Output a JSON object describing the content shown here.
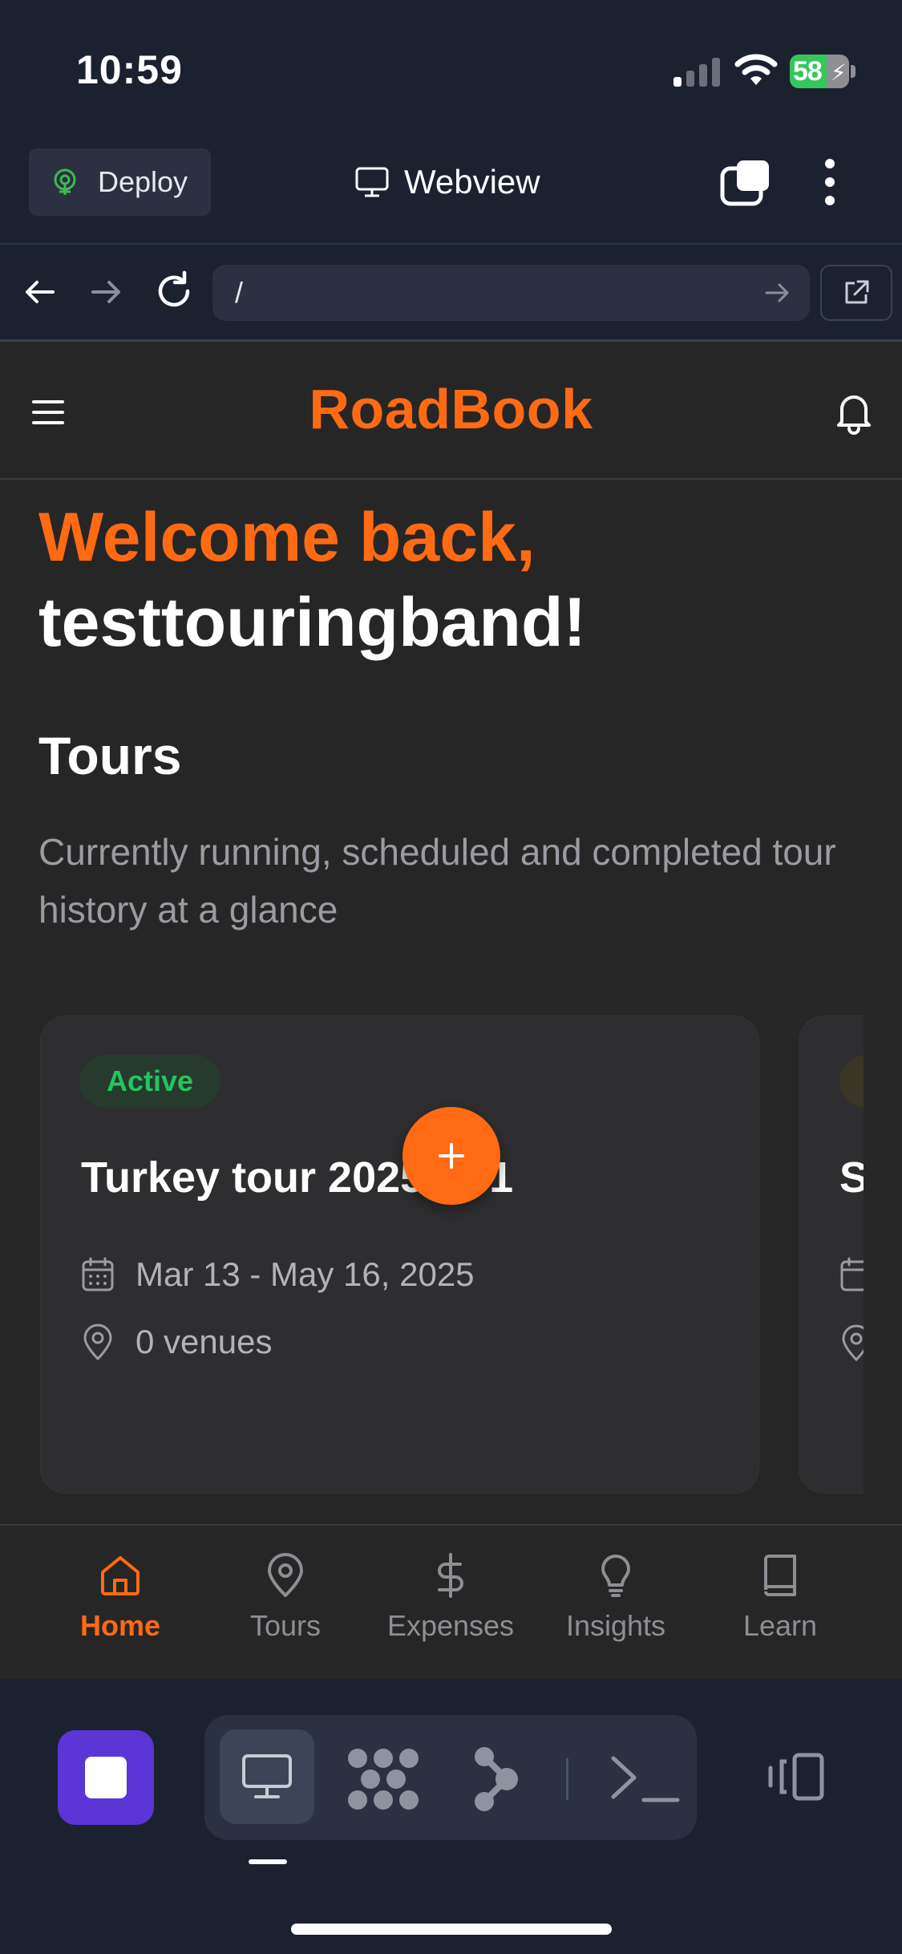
{
  "status_bar": {
    "time": "10:59",
    "battery": "58",
    "icons": [
      "signal-icon",
      "wifi-icon",
      "battery-icon"
    ]
  },
  "host_toolbar": {
    "deploy_label": "Deploy",
    "webview_label": "Webview",
    "icons": [
      "deploy-icon",
      "monitor-icon",
      "windows-icon",
      "kebab-menu-icon"
    ]
  },
  "browser": {
    "url": "/",
    "icons": [
      "back-icon",
      "forward-icon",
      "reload-icon",
      "go-arrow-icon",
      "open-external-icon"
    ]
  },
  "app": {
    "brand": "RoadBook",
    "welcome_line": "Welcome back,",
    "username_line": "testtouringband!",
    "tours_heading": "Tours",
    "tours_subtitle": "Currently running, scheduled and completed tour history at a glance",
    "tour_cards": [
      {
        "status": "Active",
        "title": "Turkey tour 2025 pt 1",
        "dates": "Mar 13 - May 16, 2025",
        "venues": "0 venues"
      },
      {
        "title": "S"
      }
    ],
    "fab_label": "+",
    "tabs": [
      {
        "label": "Home",
        "icon": "home-icon",
        "active": true
      },
      {
        "label": "Tours",
        "icon": "map-pin-icon",
        "active": false
      },
      {
        "label": "Expenses",
        "icon": "dollar-icon",
        "active": false
      },
      {
        "label": "Insights",
        "icon": "lightbulb-icon",
        "active": false
      },
      {
        "label": "Learn",
        "icon": "book-icon",
        "active": false
      }
    ]
  },
  "dock": {
    "icons": [
      "stop-icon",
      "webview-monitor-icon",
      "nodes-icon",
      "branch-icon",
      "terminal-icon",
      "devices-icon"
    ]
  },
  "colors": {
    "accent": "#ff6a13",
    "active_green": "#22c55e",
    "host_bg": "#1c2130",
    "app_bg": "#262626",
    "stop_purple": "#5b35d5"
  }
}
